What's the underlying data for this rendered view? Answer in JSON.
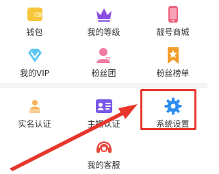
{
  "menu": {
    "items": [
      {
        "label": "钱包",
        "icon": "wallet-icon"
      },
      {
        "label": "我的等级",
        "icon": "crown-icon"
      },
      {
        "label": "靓号商城",
        "icon": "phone-icon"
      },
      {
        "label": "我的VIP",
        "icon": "diamond-icon"
      },
      {
        "label": "粉丝团",
        "icon": "fan-group-icon"
      },
      {
        "label": "粉丝榜单",
        "icon": "star-ribbon-icon"
      },
      {
        "label": "实名认证",
        "icon": "person-verify-icon"
      },
      {
        "label": "主播认证",
        "icon": "id-card-icon"
      },
      {
        "label": "系统设置",
        "icon": "gear-icon"
      },
      {
        "label": "我的客服",
        "icon": "headset-icon"
      }
    ]
  },
  "colors": {
    "highlight": "#e8362d",
    "wallet": "#f6c53a",
    "crown": "#8a4fe0",
    "phone": "#f0607a",
    "diamond": "#5ec8f2",
    "fan": "#f27ba6",
    "ribbon": "#f29c2c",
    "verify": "#f5b35a",
    "idcard": "#7a58e8",
    "gear": "#2e8cf0",
    "headset": "#e8473a"
  }
}
